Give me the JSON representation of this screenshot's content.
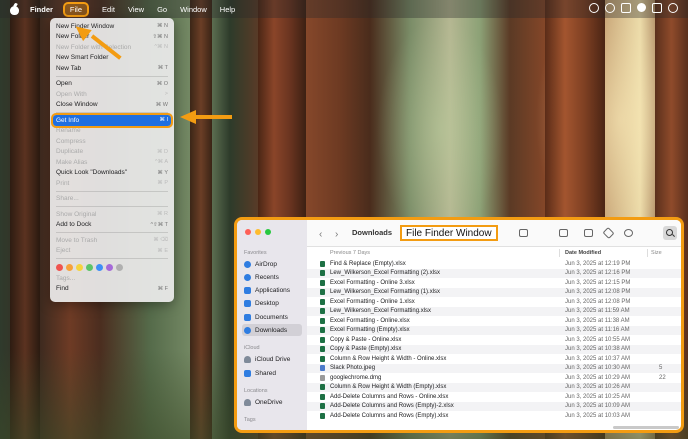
{
  "menubar": {
    "app_name": "Finder",
    "items": [
      "File",
      "Edit",
      "View",
      "Go",
      "Window",
      "Help"
    ]
  },
  "file_menu": {
    "items": [
      {
        "label": "New Finder Window",
        "shortcut": "⌘ N",
        "enabled": true
      },
      {
        "label": "New Folder",
        "shortcut": "⇧⌘ N",
        "enabled": true
      },
      {
        "label": "New Folder with Selection",
        "shortcut": "^⌘ N",
        "enabled": false
      },
      {
        "label": "New Smart Folder",
        "shortcut": "",
        "enabled": true
      },
      {
        "label": "New Tab",
        "shortcut": "⌘ T",
        "enabled": true
      },
      {
        "label": "Open",
        "shortcut": "⌘ O",
        "enabled": true
      },
      {
        "label": "Open With",
        "shortcut": ">",
        "enabled": false
      },
      {
        "label": "Close Window",
        "shortcut": "⌘ W",
        "enabled": true
      },
      {
        "label": "Get Info",
        "shortcut": "⌘ I",
        "enabled": true,
        "highlighted": true
      },
      {
        "label": "Rename",
        "shortcut": "",
        "enabled": false
      },
      {
        "label": "Compress",
        "shortcut": "",
        "enabled": false
      },
      {
        "label": "Duplicate",
        "shortcut": "⌘ D",
        "enabled": false
      },
      {
        "label": "Make Alias",
        "shortcut": "^⌘ A",
        "enabled": false
      },
      {
        "label": "Quick Look \"Downloads\"",
        "shortcut": "⌘ Y",
        "enabled": true
      },
      {
        "label": "Print",
        "shortcut": "⌘ P",
        "enabled": false
      },
      {
        "label": "Share...",
        "shortcut": "",
        "enabled": false
      },
      {
        "label": "Show Original",
        "shortcut": "⌘ R",
        "enabled": false
      },
      {
        "label": "Add to Dock",
        "shortcut": "^⇧⌘ T",
        "enabled": true
      },
      {
        "label": "Move to Trash",
        "shortcut": "⌘ ⌫",
        "enabled": false
      },
      {
        "label": "Eject",
        "shortcut": "⌘ E",
        "enabled": false
      },
      {
        "label": "Tags...",
        "shortcut": "",
        "enabled": false
      },
      {
        "label": "Find",
        "shortcut": "⌘ F",
        "enabled": true
      }
    ],
    "tag_colors": [
      "#f0544f",
      "#f7a23b",
      "#f5d33f",
      "#5cc46a",
      "#3f8ff7",
      "#a66ad8",
      "#b0b0b0"
    ]
  },
  "finder_window": {
    "title": "Downloads",
    "annotation_label": "File Finder Window",
    "sidebar": {
      "favorites_heading": "Favorites",
      "favorites": [
        "AirDrop",
        "Recents",
        "Applications",
        "Desktop",
        "Documents",
        "Downloads"
      ],
      "selected": "Downloads",
      "icloud_heading": "iCloud",
      "icloud": [
        "iCloud Drive",
        "Shared"
      ],
      "locations_heading": "Locations",
      "locations": [
        "OneDrive"
      ],
      "tags_heading": "Tags"
    },
    "columns": {
      "name": "Previous 7 Days",
      "date": "Date Modified",
      "size": "Size"
    },
    "files": [
      {
        "name": "Find & Replace (Empty).xlsx",
        "date": "Jun 3, 2025 at 12:19 PM",
        "size": "",
        "kind": "xlsx"
      },
      {
        "name": "Lew_Wilkerson_Excel Formatting (2).xlsx",
        "date": "Jun 3, 2025 at 12:16 PM",
        "size": "",
        "kind": "xlsx"
      },
      {
        "name": "Excel Formatting - Online 3.xlsx",
        "date": "Jun 3, 2025 at 12:15 PM",
        "size": "",
        "kind": "xlsx"
      },
      {
        "name": "Lew_Wilkerson_Excel Formatting (1).xlsx",
        "date": "Jun 3, 2025 at 12:08 PM",
        "size": "",
        "kind": "xlsx"
      },
      {
        "name": "Excel Formatting - Online 1.xlsx",
        "date": "Jun 3, 2025 at 12:08 PM",
        "size": "",
        "kind": "xlsx"
      },
      {
        "name": "Lew_Wilkerson_Excel Formatting.xlsx",
        "date": "Jun 3, 2025 at 11:59 AM",
        "size": "",
        "kind": "xlsx"
      },
      {
        "name": "Excel Formatting - Online.xlsx",
        "date": "Jun 3, 2025 at 11:38 AM",
        "size": "",
        "kind": "xlsx"
      },
      {
        "name": "Excel Formatting (Empty).xlsx",
        "date": "Jun 3, 2025 at 11:16 AM",
        "size": "",
        "kind": "xlsx"
      },
      {
        "name": "Copy & Paste - Online.xlsx",
        "date": "Jun 3, 2025 at 10:55 AM",
        "size": "",
        "kind": "xlsx"
      },
      {
        "name": "Copy & Paste (Empty).xlsx",
        "date": "Jun 3, 2025 at 10:38 AM",
        "size": "",
        "kind": "xlsx"
      },
      {
        "name": "Column & Row Height & Width - Online.xlsx",
        "date": "Jun 3, 2025 at 10:37 AM",
        "size": "",
        "kind": "xlsx"
      },
      {
        "name": "Slack Photo.jpeg",
        "date": "Jun 3, 2025 at 10:30 AM",
        "size": "5",
        "kind": "jpeg"
      },
      {
        "name": "googlechrome.dmg",
        "date": "Jun 3, 2025 at 10:29 AM",
        "size": "22",
        "kind": "dmg"
      },
      {
        "name": "Column & Row Height & Width (Empty).xlsx",
        "date": "Jun 3, 2025 at 10:26 AM",
        "size": "",
        "kind": "xlsx"
      },
      {
        "name": "Add-Delete Columns and Rows - Online.xlsx",
        "date": "Jun 3, 2025 at 10:25 AM",
        "size": "",
        "kind": "xlsx"
      },
      {
        "name": "Add-Delete Columns and Rows (Empty)-2.xlsx",
        "date": "Jun 3, 2025 at 10:09 AM",
        "size": "",
        "kind": "xlsx"
      },
      {
        "name": "Add-Delete Columns and Rows (Empty).xlsx",
        "date": "Jun 3, 2025 at 10:03 AM",
        "size": "",
        "kind": "xlsx"
      }
    ]
  }
}
